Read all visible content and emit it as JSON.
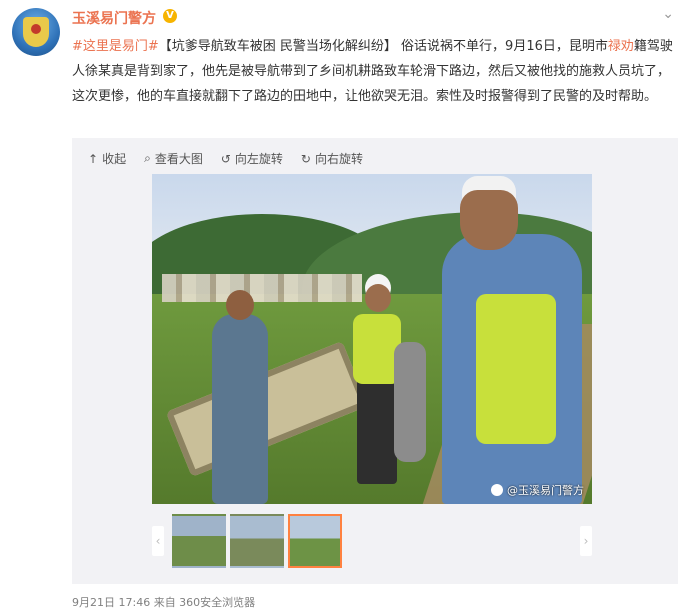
{
  "post": {
    "author": "玉溪易门警方",
    "verified_icon": "V",
    "more_icon": "chevron-down-icon",
    "topic": "#这里是易门#",
    "text_part1": "【坑爹导航致车被困 民警当场化解纠纷】 俗话说祸不单行，9月16日，昆明市",
    "location": "禄劝",
    "text_part2": "籍驾驶人徐某真是背到家了，他先是被导航带到了乡间机耕路致车轮滑下路边，然后又被他找的施救人员坑了，这次更惨，他的车直接就翻下了路边的田地中，让他欲哭无泪。索性及时报警得到了民警的及时帮助。"
  },
  "toolbar": {
    "collapse": "收起",
    "view_large": "查看大图",
    "rotate_left": "向左旋转",
    "rotate_right": "向右旋转"
  },
  "image": {
    "watermark": "@玉溪易门警方"
  },
  "footer": {
    "time": "9月21日 17:46 来自 360安全浏览器"
  }
}
